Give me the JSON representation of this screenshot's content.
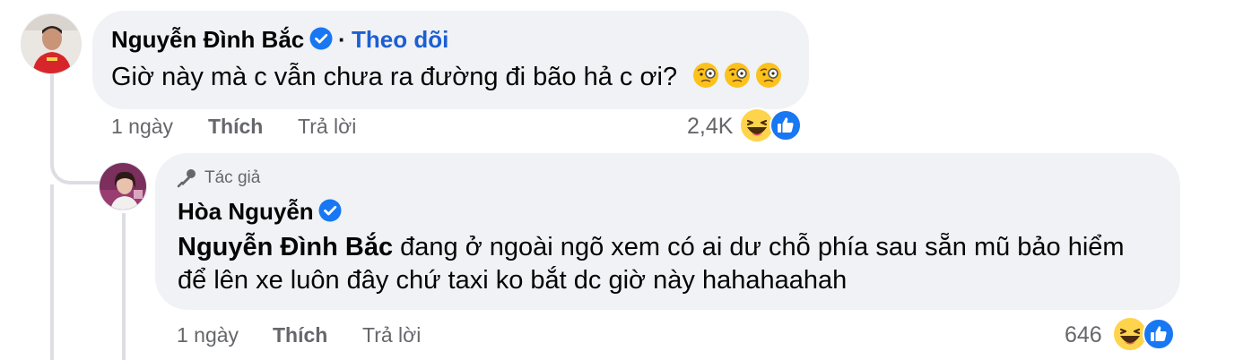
{
  "comment": {
    "author": "Nguyễn Đình Bắc",
    "follow_label": "Theo dõi",
    "separator": "·",
    "text": "Giờ này mà c vẫn chưa ra đường đi bão hả c ơi?",
    "emojis": [
      "face-with-monocle",
      "face-with-monocle",
      "face-with-monocle"
    ],
    "time": "1 ngày",
    "like_label": "Thích",
    "reply_label": "Trả lời",
    "reaction_count": "2,4K",
    "reactions": [
      "haha",
      "like"
    ]
  },
  "reply": {
    "badge": "Tác giả",
    "author": "Hòa Nguyễn",
    "mention": "Nguyễn Đình Bắc",
    "text_line1_rest": " đang ở ngoài ngõ xem có ai dư chỗ phía sau sẵn mũ bảo hiểm",
    "text_line2": "để lên xe luôn đây chứ taxi ko bắt dc giờ này hahahaahah",
    "time": "1 ngày",
    "like_label": "Thích",
    "reply_label": "Trả lời",
    "reaction_count": "646",
    "reactions": [
      "haha",
      "like"
    ]
  },
  "colors": {
    "bubble": "#f0f2f5",
    "link": "#1d5fd1",
    "verified": "#1877f2",
    "secondary_text": "#65676b",
    "thread_line": "#dcdee3"
  }
}
